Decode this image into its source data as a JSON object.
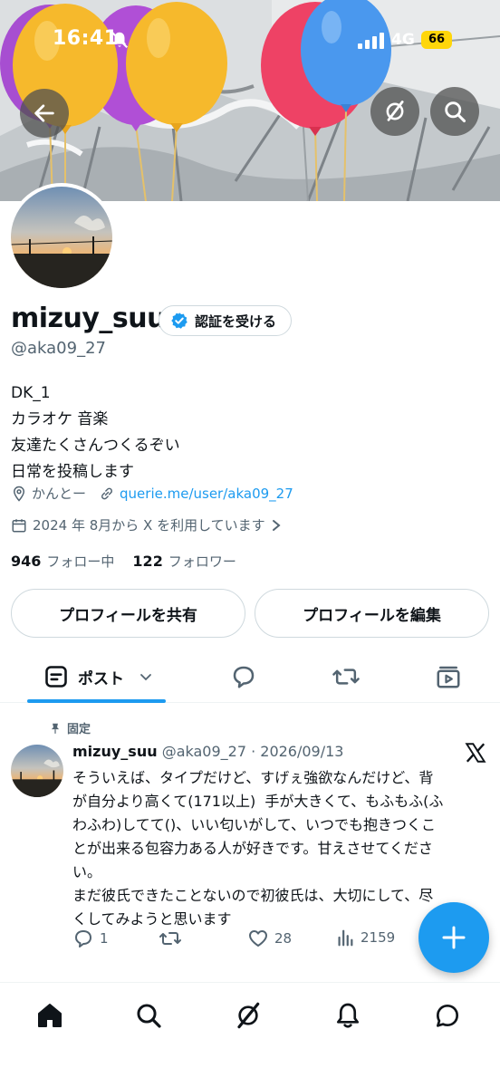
{
  "status_bar": {
    "time": "16:41",
    "network": "4G",
    "battery": "66"
  },
  "header": {
    "back_icon": "back-arrow-icon",
    "grok_icon": "grok-icon",
    "search_icon": "search-icon"
  },
  "profile": {
    "display_name": "mizuy_suu",
    "verify_label": "認証を受ける",
    "handle": "@aka09_27",
    "bio": [
      "DK_1",
      "カラオケ 音楽",
      "友達たくさんつくるぞい",
      "日常を投稿します"
    ],
    "location": "かんとー",
    "link": "querie.me/user/aka09_27",
    "joined": "2024 年 8月から X を利用しています",
    "following_count": "946",
    "following_label": "フォロー中",
    "followers_count": "122",
    "followers_label": "フォロワー",
    "share_button": "プロフィールを共有",
    "edit_button": "プロフィールを編集"
  },
  "tabs": {
    "posts_label": "ポスト",
    "icons": [
      "posts-icon",
      "replies-icon",
      "reposts-icon",
      "media-icon"
    ]
  },
  "pinned_post": {
    "pinned_label": "固定",
    "author": "mizuy_suu",
    "meta": "@aka09_27 · 2026/09/13",
    "text": "そういえば、タイプだけど、すげぇ強欲なんだけど、背\nが自分より高くて(171以上)  手が大きくて、もふもふ(ふ\nわふわ)してて()、いい匂いがして、いつでも抱きつくこ\nとが出来る包容力ある人が好きです。甘えさせてくださ\nい。\nまだ彼氏できたことないので初彼氏は、大切にして、尽\nくしてみようと思います",
    "replies": "1",
    "reposts": "",
    "likes": "28",
    "views": "2159"
  },
  "bottom_nav": [
    "home-icon",
    "search-icon",
    "grok-icon",
    "notifications-icon",
    "messages-icon"
  ],
  "colors": {
    "accent": "#1d9bf0",
    "text": "#0f1419",
    "secondary": "#536471",
    "battery": "#ffd60a"
  }
}
